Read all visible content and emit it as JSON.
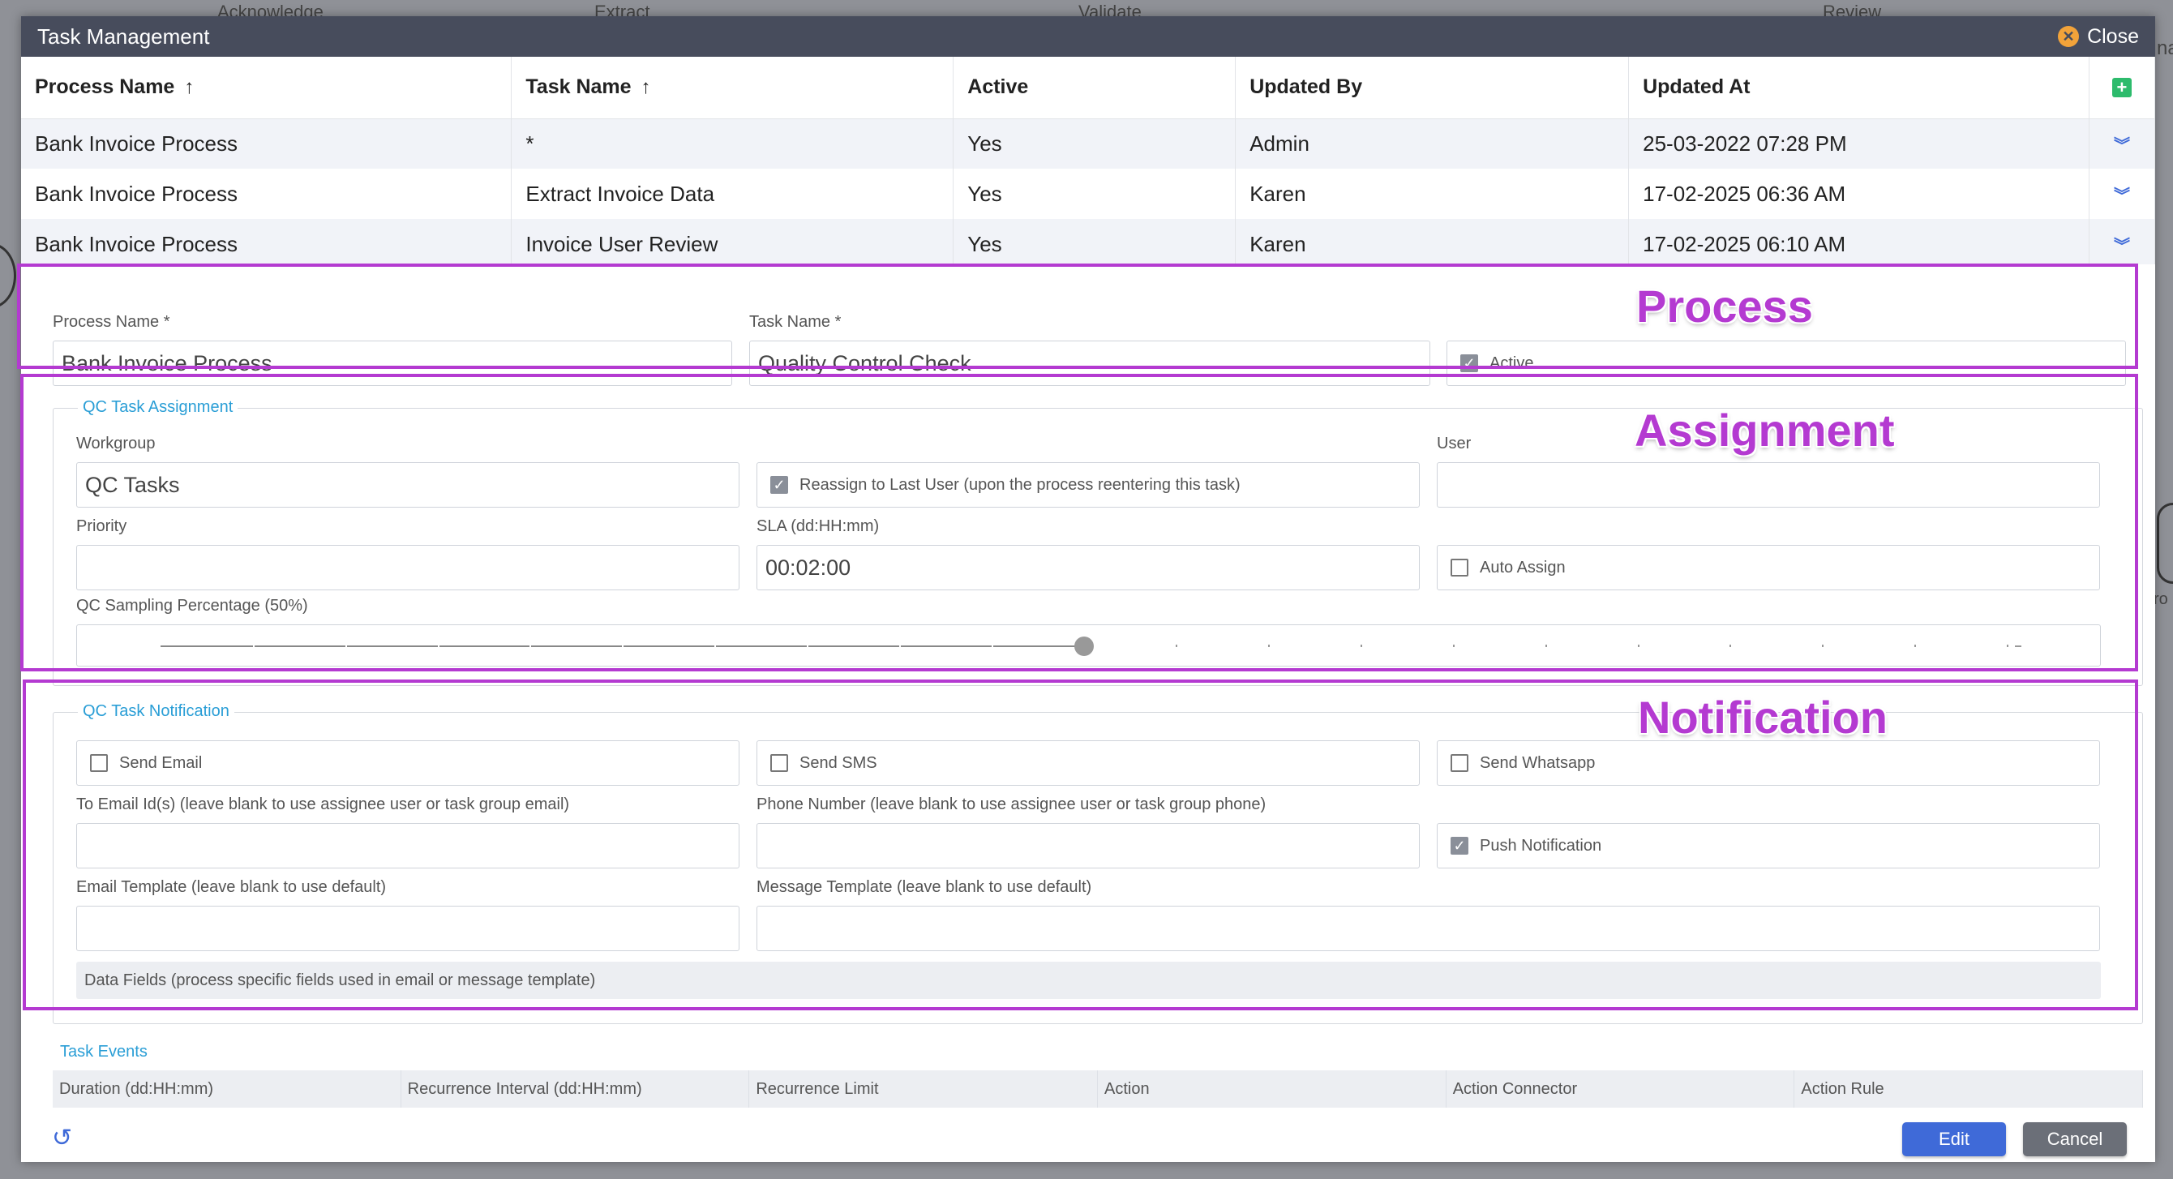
{
  "background": {
    "labels": [
      "Acknowledge",
      "Extract",
      "Validate",
      "Review"
    ],
    "edge_text_right_top": "na",
    "edge_text_right_mid": "ro"
  },
  "dialog": {
    "title": "Task Management",
    "close_label": "Close"
  },
  "grid": {
    "columns": [
      "Process Name",
      "Task Name",
      "Active",
      "Updated By",
      "Updated At"
    ],
    "rows": [
      {
        "process": "Bank Invoice Process",
        "task": "*",
        "active": "Yes",
        "updated_by": "Admin",
        "updated_at": "25-03-2022 07:28 PM"
      },
      {
        "process": "Bank Invoice Process",
        "task": "Extract Invoice Data",
        "active": "Yes",
        "updated_by": "Karen",
        "updated_at": "17-02-2025 06:36 AM"
      },
      {
        "process": "Bank Invoice Process",
        "task": "Invoice User Review",
        "active": "Yes",
        "updated_by": "Karen",
        "updated_at": "17-02-2025 06:10 AM"
      }
    ]
  },
  "annotations": {
    "process": "Process",
    "assignment": "Assignment",
    "notification": "Notification"
  },
  "process_section": {
    "process_name_label": "Process Name *",
    "process_name_value": "Bank Invoice Process",
    "task_name_label": "Task Name *",
    "task_name_value": "Quality Control Check",
    "active_label": "Active",
    "active_checked": true
  },
  "assignment": {
    "legend": "QC Task Assignment",
    "workgroup_label": "Workgroup",
    "workgroup_value": "QC Tasks",
    "reassign_label": "Reassign to Last User (upon the process reentering this task)",
    "reassign_checked": true,
    "user_label": "User",
    "user_value": "",
    "priority_label": "Priority",
    "priority_value": "",
    "sla_label": "SLA (dd:HH:mm)",
    "sla_value": "00:02:00",
    "auto_assign_label": "Auto Assign",
    "auto_assign_checked": false,
    "sampling_label": "QC Sampling Percentage (50%)",
    "sampling_percent": 50
  },
  "notification": {
    "legend": "QC Task Notification",
    "send_email_label": "Send Email",
    "send_sms_label": "Send SMS",
    "send_whatsapp_label": "Send Whatsapp",
    "to_email_label": "To Email Id(s) (leave blank to use assignee user or task group email)",
    "phone_label": "Phone Number (leave blank to use assignee user or task group phone)",
    "push_label": "Push Notification",
    "push_checked": true,
    "email_template_label": "Email Template (leave blank to use default)",
    "message_template_label": "Message Template (leave blank to use default)",
    "data_fields_label": "Data Fields (process specific fields used in email or message template)"
  },
  "task_events": {
    "title": "Task Events",
    "columns": [
      "Duration (dd:HH:mm)",
      "Recurrence Interval (dd:HH:mm)",
      "Recurrence Limit",
      "Action",
      "Action Connector",
      "Action Rule"
    ]
  },
  "footer": {
    "edit_label": "Edit",
    "cancel_label": "Cancel"
  },
  "colors": {
    "titlebar": "#474c5c",
    "annotation": "#b43ad1",
    "primary_button": "#3f6ad8",
    "legend_text": "#2a9ed6"
  }
}
